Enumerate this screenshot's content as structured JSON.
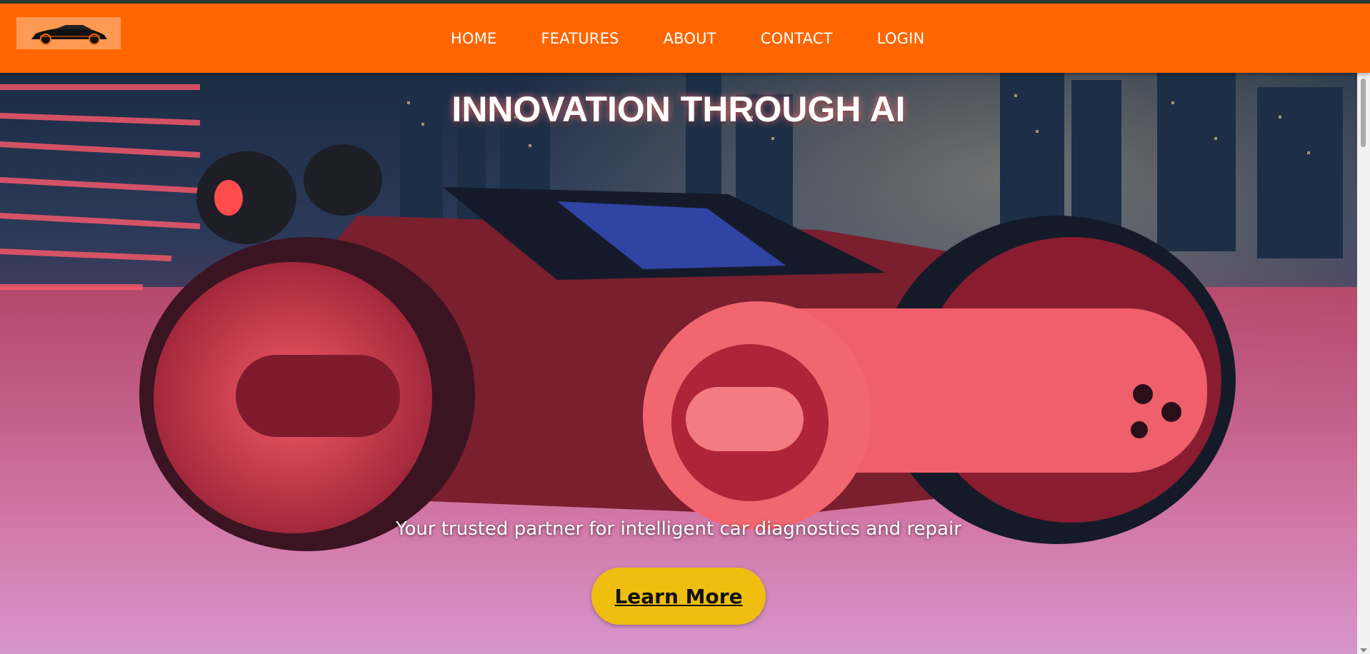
{
  "nav": {
    "logo_icon": "sports-car-logo",
    "links": [
      "HOME",
      "FEATURES",
      "ABOUT",
      "CONTACT",
      "LOGIN"
    ]
  },
  "hero": {
    "title": "INNOVATION THROUGH AI",
    "subtitle": "Your trusted partner for intelligent car diagnostics and repair",
    "cta_label": "Learn More",
    "image": "futuristic-red-vehicle-city-background"
  },
  "colors": {
    "nav_background": "#ff6600",
    "cta_background": "#f0be10",
    "text": "#ffffff"
  }
}
